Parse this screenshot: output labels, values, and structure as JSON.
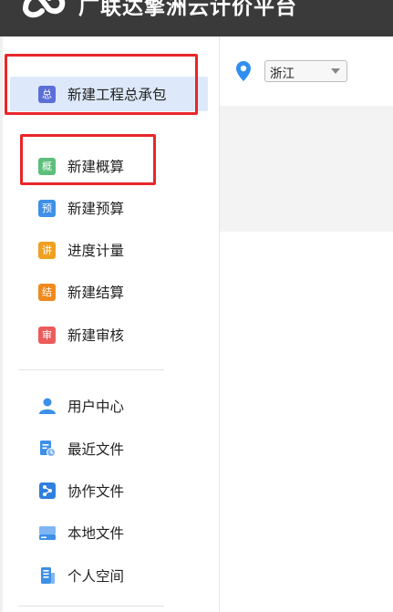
{
  "app": {
    "title": "广联达擎洲云计价平台"
  },
  "sidebar": {
    "primary": [
      {
        "key": "general-contract",
        "label": "新建工程总承包",
        "badge": "总",
        "color": "#5b6fd8",
        "active": true
      },
      {
        "key": "estimate",
        "label": "新建概算",
        "badge": "概",
        "color": "#5cbf7a",
        "active": false
      },
      {
        "key": "budget",
        "label": "新建预算",
        "badge": "预",
        "color": "#3d8fe8",
        "active": false
      },
      {
        "key": "progress",
        "label": "进度计量",
        "badge": "讲",
        "color": "#f0a020",
        "active": false
      },
      {
        "key": "settlement",
        "label": "新建结算",
        "badge": "结",
        "color": "#f08a1e",
        "active": false
      },
      {
        "key": "audit",
        "label": "新建审核",
        "badge": "审",
        "color": "#ec5b5b",
        "active": false
      }
    ],
    "secondary": [
      {
        "key": "user-center",
        "label": "用户中心",
        "icon": "user-icon"
      },
      {
        "key": "recent-files",
        "label": "最近文件",
        "icon": "recent-file-icon"
      },
      {
        "key": "collab-files",
        "label": "协作文件",
        "icon": "share-file-icon"
      },
      {
        "key": "local-files",
        "label": "本地文件",
        "icon": "local-drive-icon"
      },
      {
        "key": "personal-space",
        "label": "个人空间",
        "icon": "personal-space-icon"
      }
    ]
  },
  "location": {
    "icon": "location-pin-icon",
    "province": "浙江"
  },
  "colors": {
    "titlebar": "#3a3a3a",
    "highlight": "#e8262a",
    "active_bg": "#dde9fb",
    "icon_blue": "#3d8fe8"
  }
}
